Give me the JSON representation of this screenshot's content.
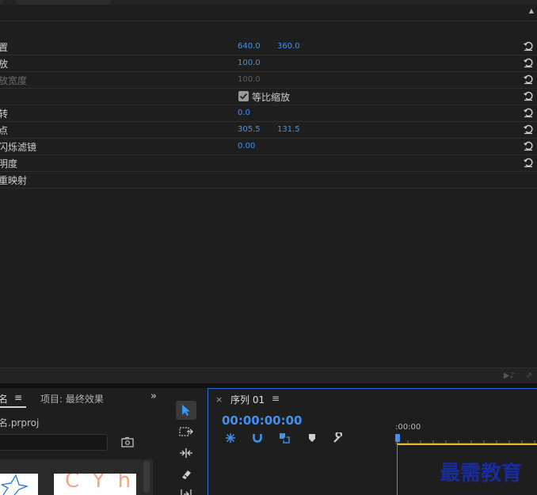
{
  "effects": {
    "rows": [
      {
        "label": "置",
        "values": [
          "640.0",
          "360.0"
        ],
        "reset": true
      },
      {
        "label": "放",
        "values": [
          "100.0"
        ],
        "reset": true
      },
      {
        "label": "放宽度",
        "values": [
          "100.0"
        ],
        "reset": true,
        "disabled": true
      },
      {
        "label": "",
        "checkbox_label": "等比缩放",
        "checked": true,
        "reset": true
      },
      {
        "label": "转",
        "values": [
          "0.0"
        ],
        "reset": true
      },
      {
        "label": "点",
        "values": [
          "305.5",
          "131.5"
        ],
        "reset": true
      },
      {
        "label": "闪烁滤镜",
        "values": [
          "0.00"
        ],
        "reset": true
      },
      {
        "label": "明度",
        "values": [],
        "reset": true
      },
      {
        "label": "重映射",
        "values": [],
        "reset": false
      }
    ]
  },
  "project": {
    "tab_name": "名",
    "tab_menu": "≡",
    "tab_project": "项目: 最终效果",
    "more": "»",
    "filename": "名.prproj",
    "thumb2_text": "C Y h"
  },
  "timeline": {
    "close": "×",
    "sequence_name": "序列 01",
    "menu": "≡",
    "timecode": "00:00:00:00",
    "ruler_time": ":00:00",
    "watermark": "最需教育"
  }
}
